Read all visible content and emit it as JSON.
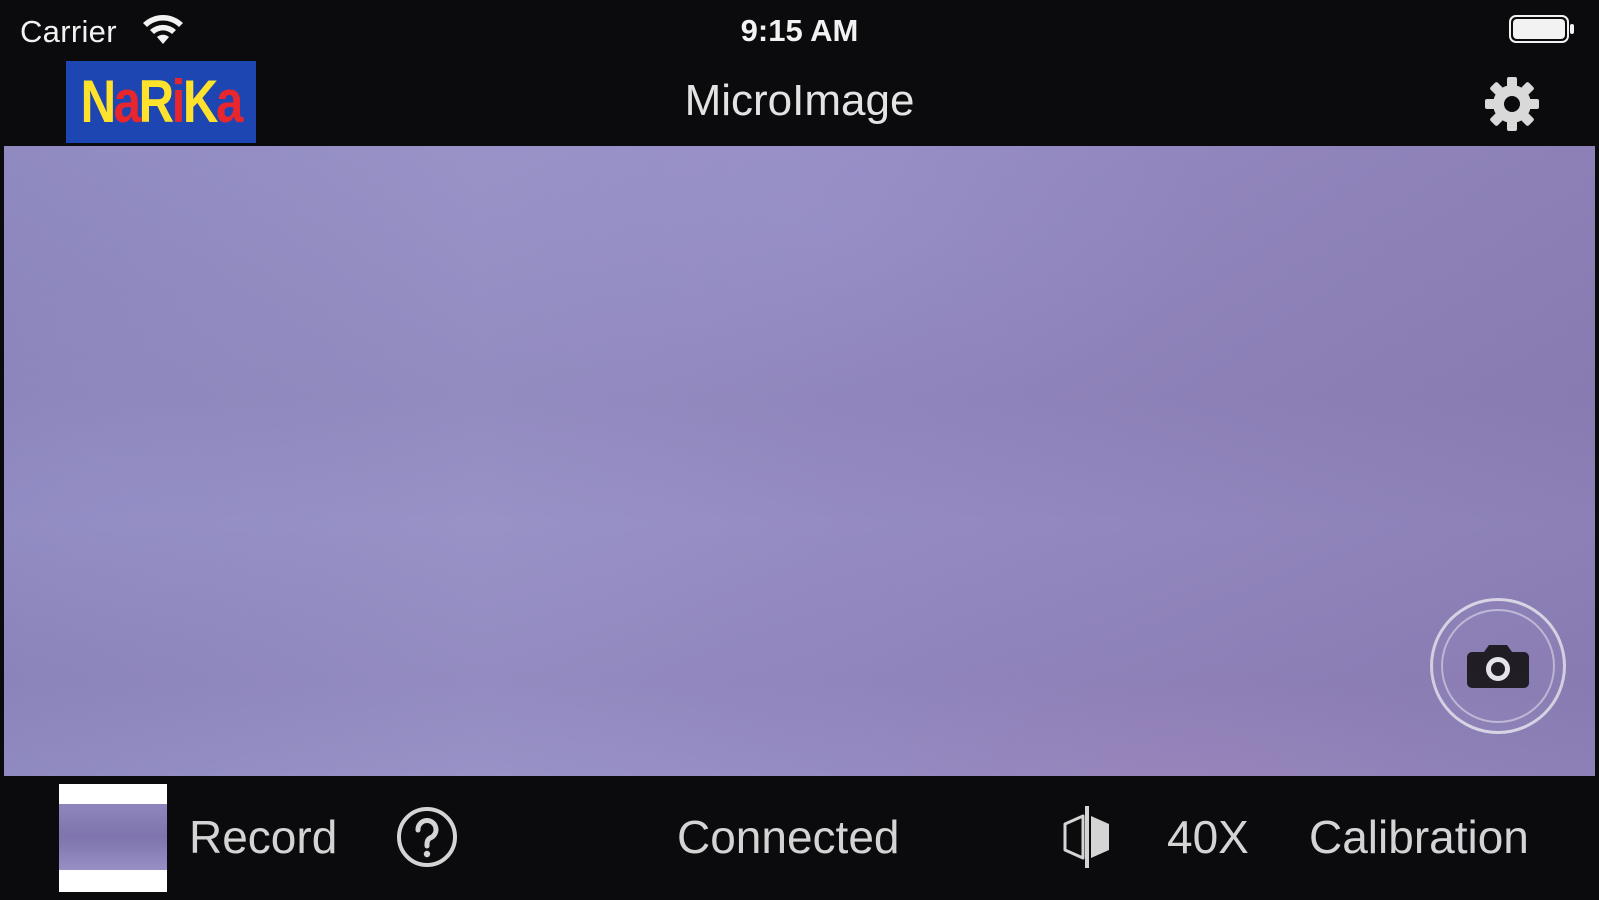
{
  "status_bar": {
    "carrier": "Carrier",
    "time": "9:15 AM",
    "icons": [
      "wifi-icon",
      "battery-icon"
    ]
  },
  "nav": {
    "logo_parts": [
      "N",
      "a",
      "R",
      "i",
      "K",
      "a"
    ],
    "title": "MicroImage",
    "settings_icon": "gear-icon"
  },
  "camera": {
    "shutter_icon": "camera-icon"
  },
  "toolbar": {
    "record_label": "Record",
    "help_icon": "question-circle-icon",
    "status": "Connected",
    "light_icon": "light-toggle-icon",
    "magnification": "40X",
    "calibration_label": "Calibration"
  },
  "colors": {
    "background": "#0b0b0d",
    "logo_bg": "#1d46b3",
    "logo_yellow": "#ffe22b",
    "logo_red": "#e8262b",
    "camera_tint": "#9590c5"
  }
}
